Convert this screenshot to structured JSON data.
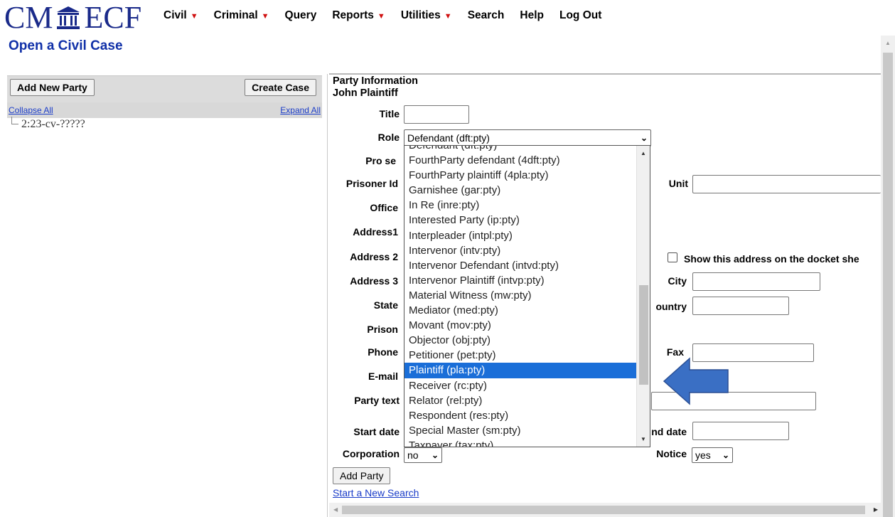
{
  "brand": {
    "left": "CM",
    "right": "ECF"
  },
  "menu": [
    {
      "label": "Civil",
      "has_caret": true
    },
    {
      "label": "Criminal",
      "has_caret": true
    },
    {
      "label": "Query",
      "has_caret": false
    },
    {
      "label": "Reports",
      "has_caret": true
    },
    {
      "label": "Utilities",
      "has_caret": true
    },
    {
      "label": "Search",
      "has_caret": false
    },
    {
      "label": "Help",
      "has_caret": false
    },
    {
      "label": "Log Out",
      "has_caret": false
    }
  ],
  "page_title": "Open a Civil Case",
  "tree": {
    "add_party_label": "Add New Party",
    "create_case_label": "Create Case",
    "collapse_label": "Collapse All",
    "expand_label": "Expand All",
    "case_node": "2:23-cv-?????"
  },
  "party": {
    "section_title": "Party Information",
    "party_name": "John Plaintiff",
    "labels": {
      "title": "Title",
      "role": "Role",
      "pro_se": "Pro se",
      "prisoner_id": "Prisoner Id",
      "office": "Office",
      "address1": "Address1",
      "address2": "Address 2",
      "address3": "Address 3",
      "state": "State",
      "prison": "Prison",
      "phone": "Phone",
      "email": "E-mail",
      "party_text": "Party text",
      "start_date": "Start date",
      "corporation": "Corporation",
      "unit": "Unit",
      "show_address": "Show this address on the docket she",
      "city": "City",
      "country": "ountry",
      "fax": "Fax",
      "end_date": "nd date",
      "notice": "Notice"
    },
    "role_value": "Defendant (dft:pty)",
    "corporation_value": "no",
    "notice_value": "yes",
    "add_party_button": "Add Party",
    "new_search_link": "Start a New Search"
  },
  "role_options": [
    "Defendant (dft:pty)",
    "FourthParty defendant (4dft:pty)",
    "FourthParty plaintiff (4pla:pty)",
    "Garnishee (gar:pty)",
    "In Re (inre:pty)",
    "Interested Party (ip:pty)",
    "Interpleader (intpl:pty)",
    "Intervenor (intv:pty)",
    "Intervenor Defendant (intvd:pty)",
    "Intervenor Plaintiff (intvp:pty)",
    "Material Witness (mw:pty)",
    "Mediator (med:pty)",
    "Movant (mov:pty)",
    "Objector (obj:pty)",
    "Petitioner (pet:pty)",
    "Plaintiff (pla:pty)",
    "Receiver (rc:pty)",
    "Relator (rel:pty)",
    "Respondent (res:pty)",
    "Special Master (sm:pty)",
    "Taxpayer (tax:pty)"
  ],
  "selected_option": "Plaintiff (pla:pty)",
  "colors": {
    "brand": "#1a2a8a",
    "link": "#1a3cc8",
    "highlight": "#1a6ed8",
    "arrow": "#3a6fc4"
  }
}
